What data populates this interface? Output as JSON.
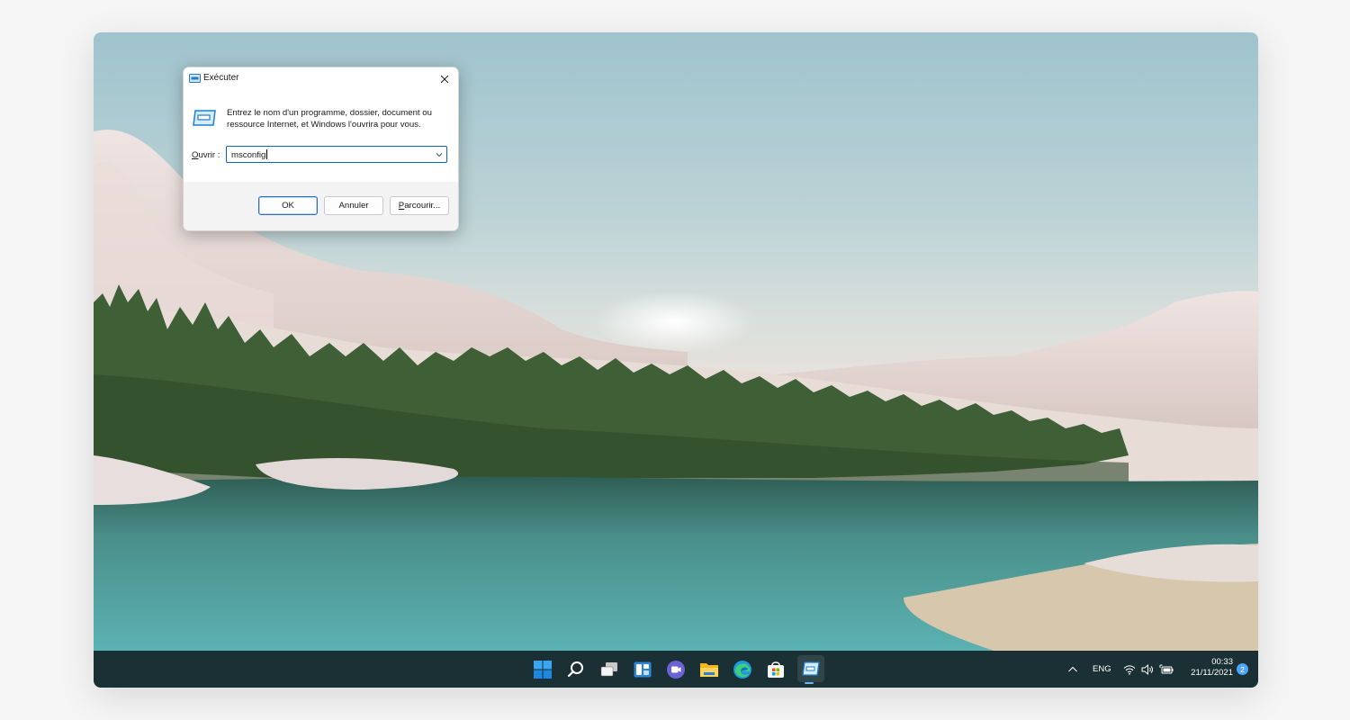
{
  "dialog": {
    "title": "Exécuter",
    "description": "Entrez le nom d'un programme, dossier, document ou ressource Internet, et Windows l'ouvrira pour vous.",
    "open_label_prefix": "O",
    "open_label_rest": "uvrir :",
    "open_value": "msconfig",
    "ok_label": "OK",
    "cancel_label": "Annuler",
    "browse_label_prefix": "P",
    "browse_label_rest": "arcourir..."
  },
  "taskbar": {
    "icons": [
      "windows-start-icon",
      "search-icon",
      "task-view-icon",
      "widgets-icon",
      "teams-chat-icon",
      "file-explorer-icon",
      "edge-browser-icon",
      "microsoft-store-icon",
      "run-app-icon"
    ],
    "active_app": "run-app-icon"
  },
  "tray": {
    "language": "ENG",
    "time": "00:33",
    "date": "21/11/2021",
    "notification_count": "2"
  },
  "colors": {
    "accent": "#0b63c4",
    "taskbar": "#16282c",
    "notification_badge": "#4ca6f5"
  }
}
